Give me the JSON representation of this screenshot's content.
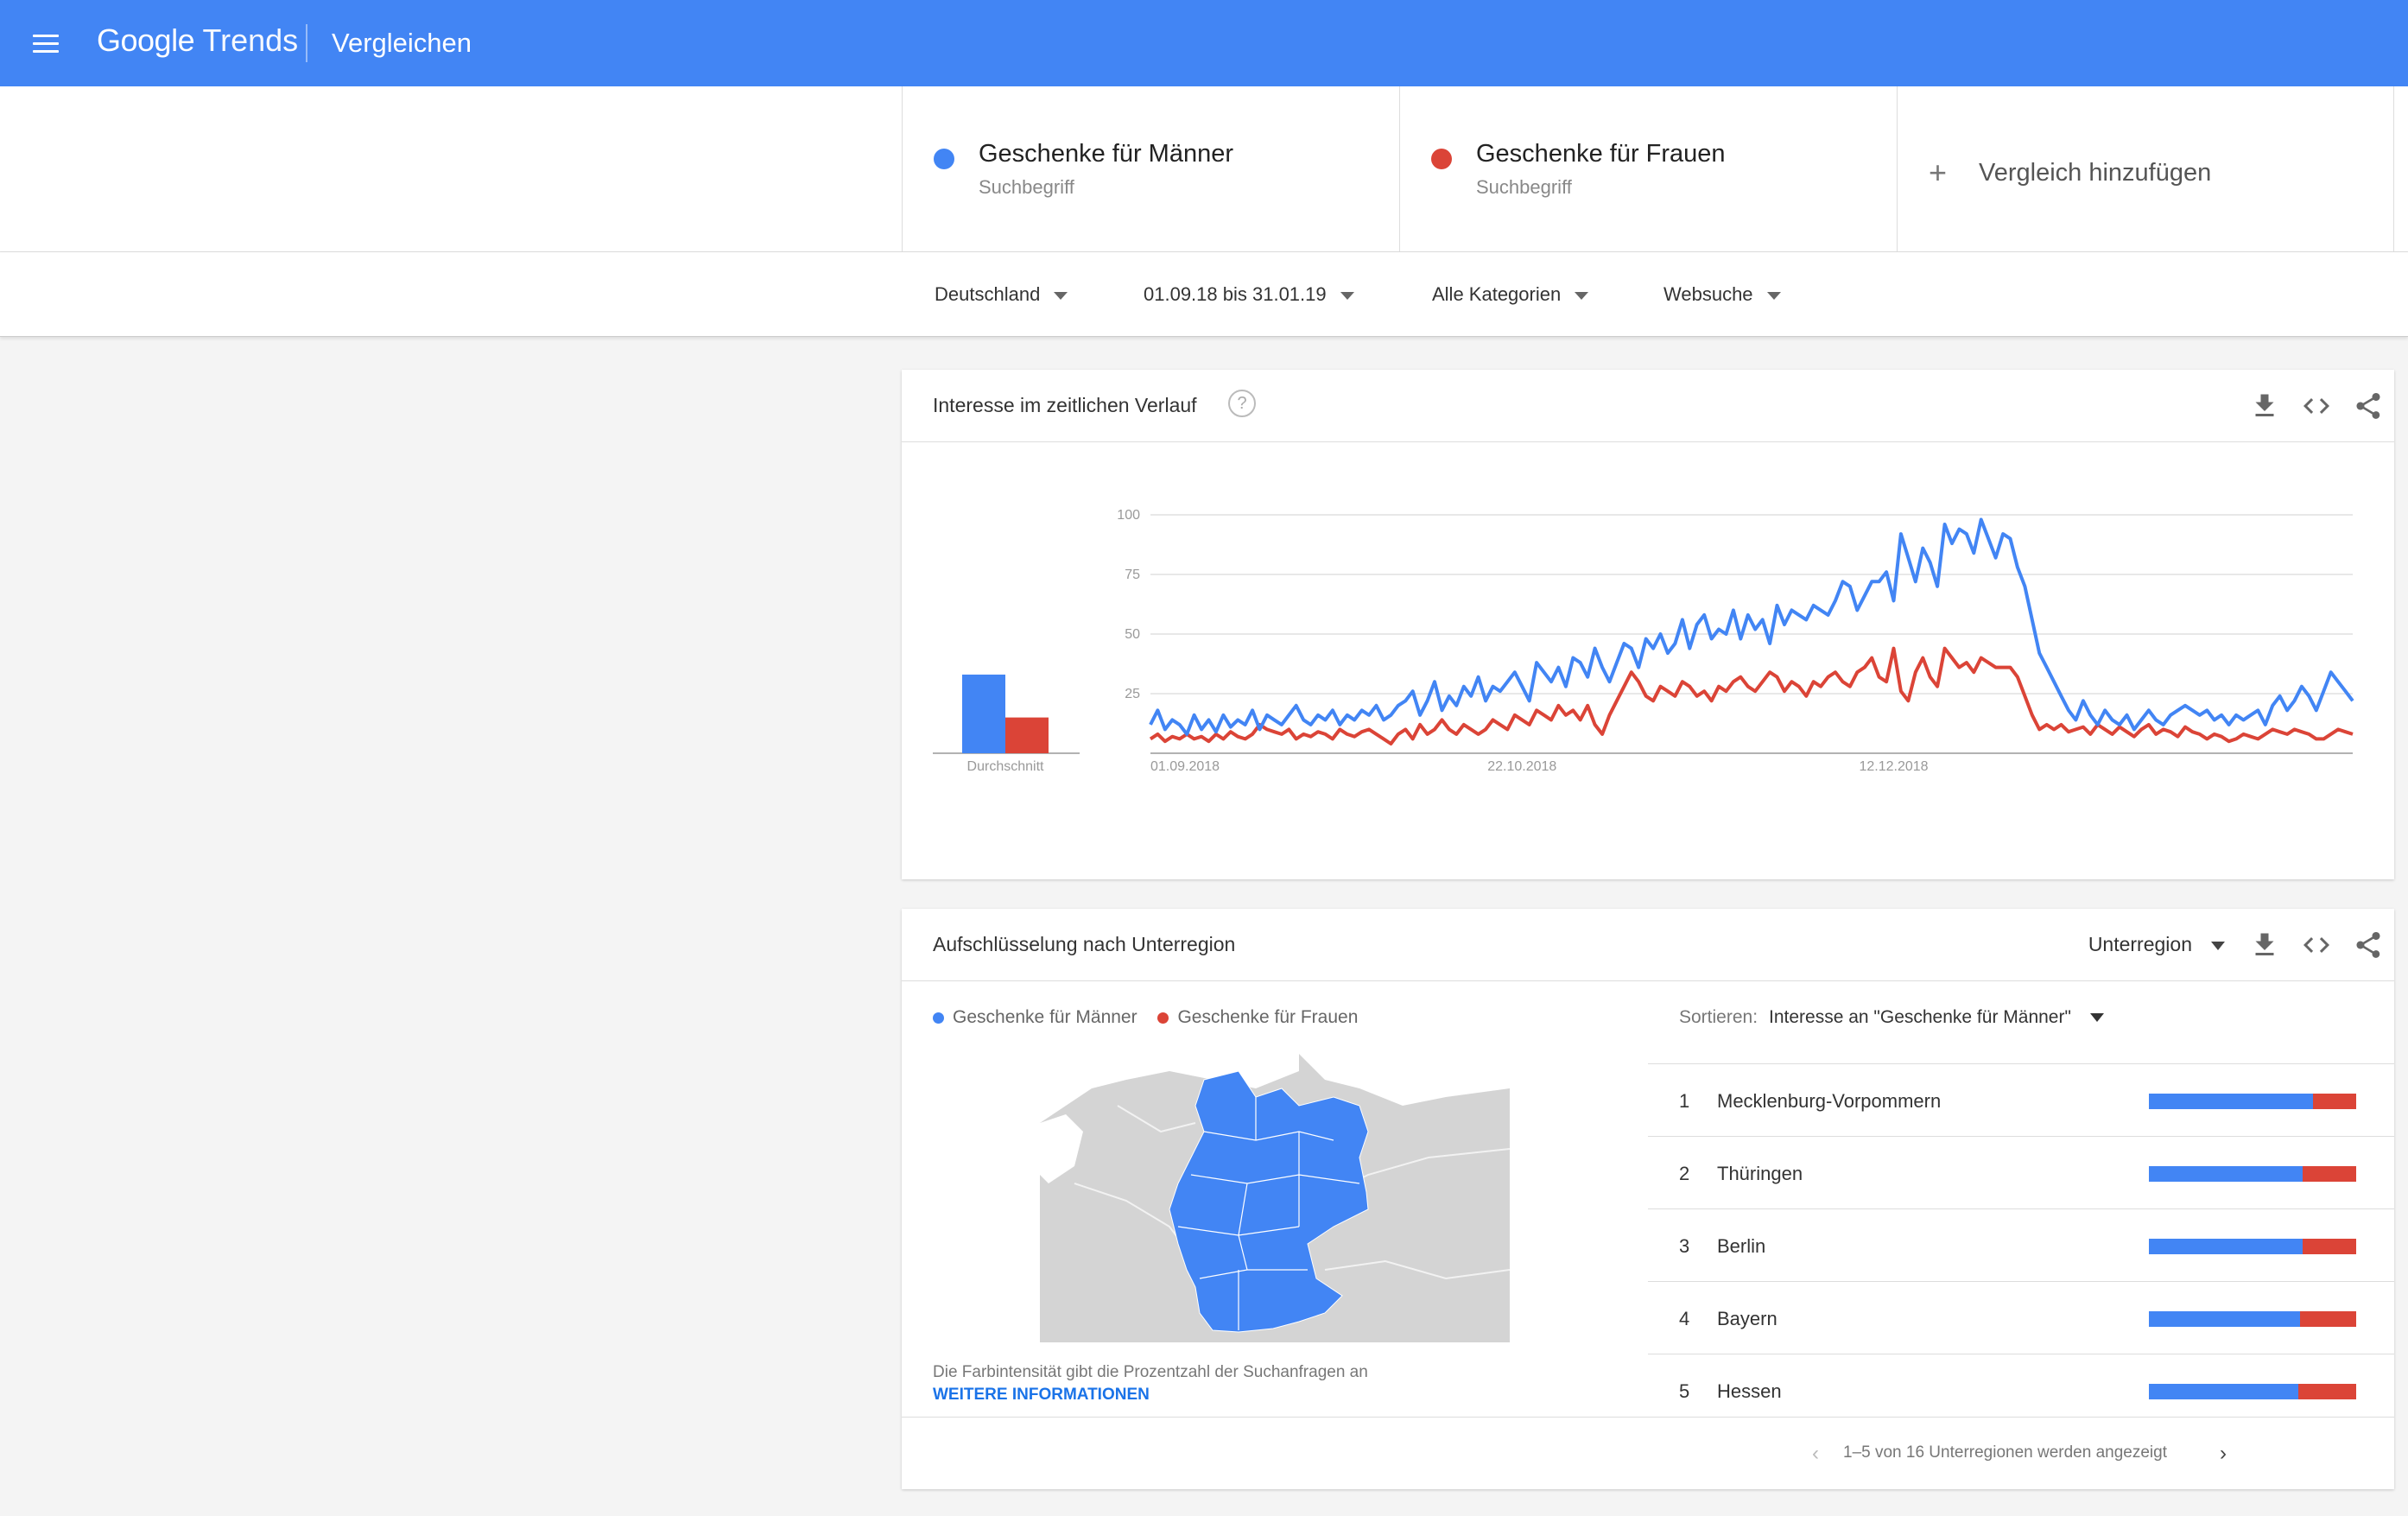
{
  "header": {
    "logo_google": "Google",
    "logo_trends": "Trends",
    "title": "Vergleichen",
    "color": "#4285f4"
  },
  "terms": [
    {
      "name": "Geschenke für Männer",
      "type": "Suchbegriff",
      "color": "#4285f4"
    },
    {
      "name": "Geschenke für Frauen",
      "type": "Suchbegriff",
      "color": "#db4437"
    }
  ],
  "add_compare": {
    "label": "Vergleich hinzufügen",
    "icon": "plus-icon"
  },
  "filters": {
    "region": "Deutschland",
    "date_range": "01.09.18 bis 31.01.19",
    "category": "Alle Kategorien",
    "search_type": "Websuche"
  },
  "interest_card": {
    "title": "Interesse im zeitlichen Verlauf",
    "help_icon": "?",
    "icons": [
      "download-icon",
      "embed-icon",
      "share-icon"
    ]
  },
  "chart_data": {
    "type": "line",
    "y_ticks": [
      "100",
      "75",
      "50",
      "25"
    ],
    "ylim": [
      0,
      100
    ],
    "x_ticks": [
      "01.09.2018",
      "22.10.2018",
      "12.12.2018"
    ],
    "average_label": "Durchschnitt",
    "averages": [
      33,
      15
    ],
    "series": [
      {
        "name": "Geschenke für Männer",
        "color": "#4285f4",
        "values": [
          12,
          18,
          10,
          14,
          12,
          8,
          16,
          10,
          14,
          9,
          16,
          11,
          14,
          12,
          18,
          10,
          16,
          14,
          12,
          16,
          20,
          14,
          12,
          16,
          14,
          18,
          12,
          16,
          14,
          18,
          16,
          20,
          14,
          16,
          20,
          22,
          26,
          16,
          22,
          30,
          18,
          24,
          20,
          28,
          24,
          32,
          22,
          28,
          26,
          30,
          34,
          28,
          22,
          38,
          34,
          30,
          36,
          28,
          40,
          38,
          32,
          44,
          36,
          30,
          38,
          46,
          44,
          36,
          48,
          44,
          50,
          42,
          46,
          56,
          44,
          54,
          58,
          48,
          52,
          50,
          60,
          48,
          58,
          52,
          56,
          46,
          62,
          54,
          60,
          58,
          56,
          62,
          60,
          58,
          64,
          72,
          70,
          60,
          66,
          72,
          72,
          76,
          64,
          92,
          82,
          72,
          86,
          80,
          70,
          96,
          88,
          94,
          92,
          84,
          98,
          90,
          82,
          92,
          90,
          78,
          70,
          56,
          42,
          36,
          30,
          24,
          18,
          14,
          22,
          16,
          12,
          18,
          14,
          12,
          16,
          10,
          14,
          18,
          14,
          12,
          16,
          18,
          20,
          18,
          16,
          18,
          14,
          16,
          12,
          16,
          14,
          16,
          18,
          12,
          20,
          24,
          18,
          22,
          28,
          24,
          18,
          26,
          34,
          30,
          26,
          22
        ],
        "label_note": ""
      },
      {
        "name": "Geschenke für Frauen",
        "color": "#db4437",
        "values": [
          6,
          8,
          5,
          7,
          6,
          8,
          6,
          7,
          5,
          8,
          6,
          9,
          7,
          6,
          8,
          12,
          10,
          9,
          8,
          10,
          6,
          8,
          7,
          9,
          8,
          6,
          10,
          8,
          7,
          9,
          10,
          8,
          6,
          4,
          8,
          10,
          6,
          12,
          8,
          10,
          14,
          10,
          8,
          12,
          10,
          8,
          10,
          14,
          12,
          10,
          16,
          14,
          12,
          18,
          16,
          14,
          20,
          16,
          18,
          14,
          20,
          12,
          8,
          16,
          22,
          28,
          34,
          30,
          24,
          22,
          28,
          26,
          24,
          30,
          28,
          24,
          26,
          22,
          28,
          26,
          30,
          32,
          28,
          26,
          30,
          34,
          32,
          26,
          30,
          28,
          24,
          30,
          28,
          32,
          34,
          30,
          28,
          34,
          36,
          40,
          32,
          30,
          44,
          26,
          22,
          34,
          40,
          32,
          28,
          44,
          40,
          36,
          38,
          34,
          40,
          38,
          36,
          36,
          36,
          32,
          24,
          16,
          10,
          12,
          10,
          12,
          9,
          10,
          11,
          8,
          12,
          10,
          8,
          11,
          9,
          7,
          10,
          12,
          8,
          10,
          9,
          7,
          11,
          9,
          8,
          6,
          8,
          7,
          5,
          6,
          8,
          7,
          6,
          8,
          10,
          9,
          8,
          10,
          9,
          8,
          6,
          6,
          8,
          10,
          9,
          8
        ]
      }
    ]
  },
  "region_card": {
    "title": "Aufschlüsselung nach Unterregion",
    "resolution": "Unterregion",
    "legend": [
      "Geschenke für Männer",
      "Geschenke für Frauen"
    ],
    "map_note": "Die Farbintensität gibt die Prozentzahl der Suchanfragen an",
    "map_link": "WEITERE INFORMATIONEN",
    "sort_label": "Sortieren:",
    "sort_value": "Interesse an \"Geschenke für Männer\"",
    "rows": [
      {
        "rank": "1",
        "name": "Mecklenburg-Vorpommern",
        "share_m": 0.79
      },
      {
        "rank": "2",
        "name": "Thüringen",
        "share_m": 0.74
      },
      {
        "rank": "3",
        "name": "Berlin",
        "share_m": 0.74
      },
      {
        "rank": "4",
        "name": "Bayern",
        "share_m": 0.73
      },
      {
        "rank": "5",
        "name": "Hessen",
        "share_m": 0.72
      }
    ],
    "pager_text": "1–5 von 16 Unterregionen werden angezeigt"
  }
}
